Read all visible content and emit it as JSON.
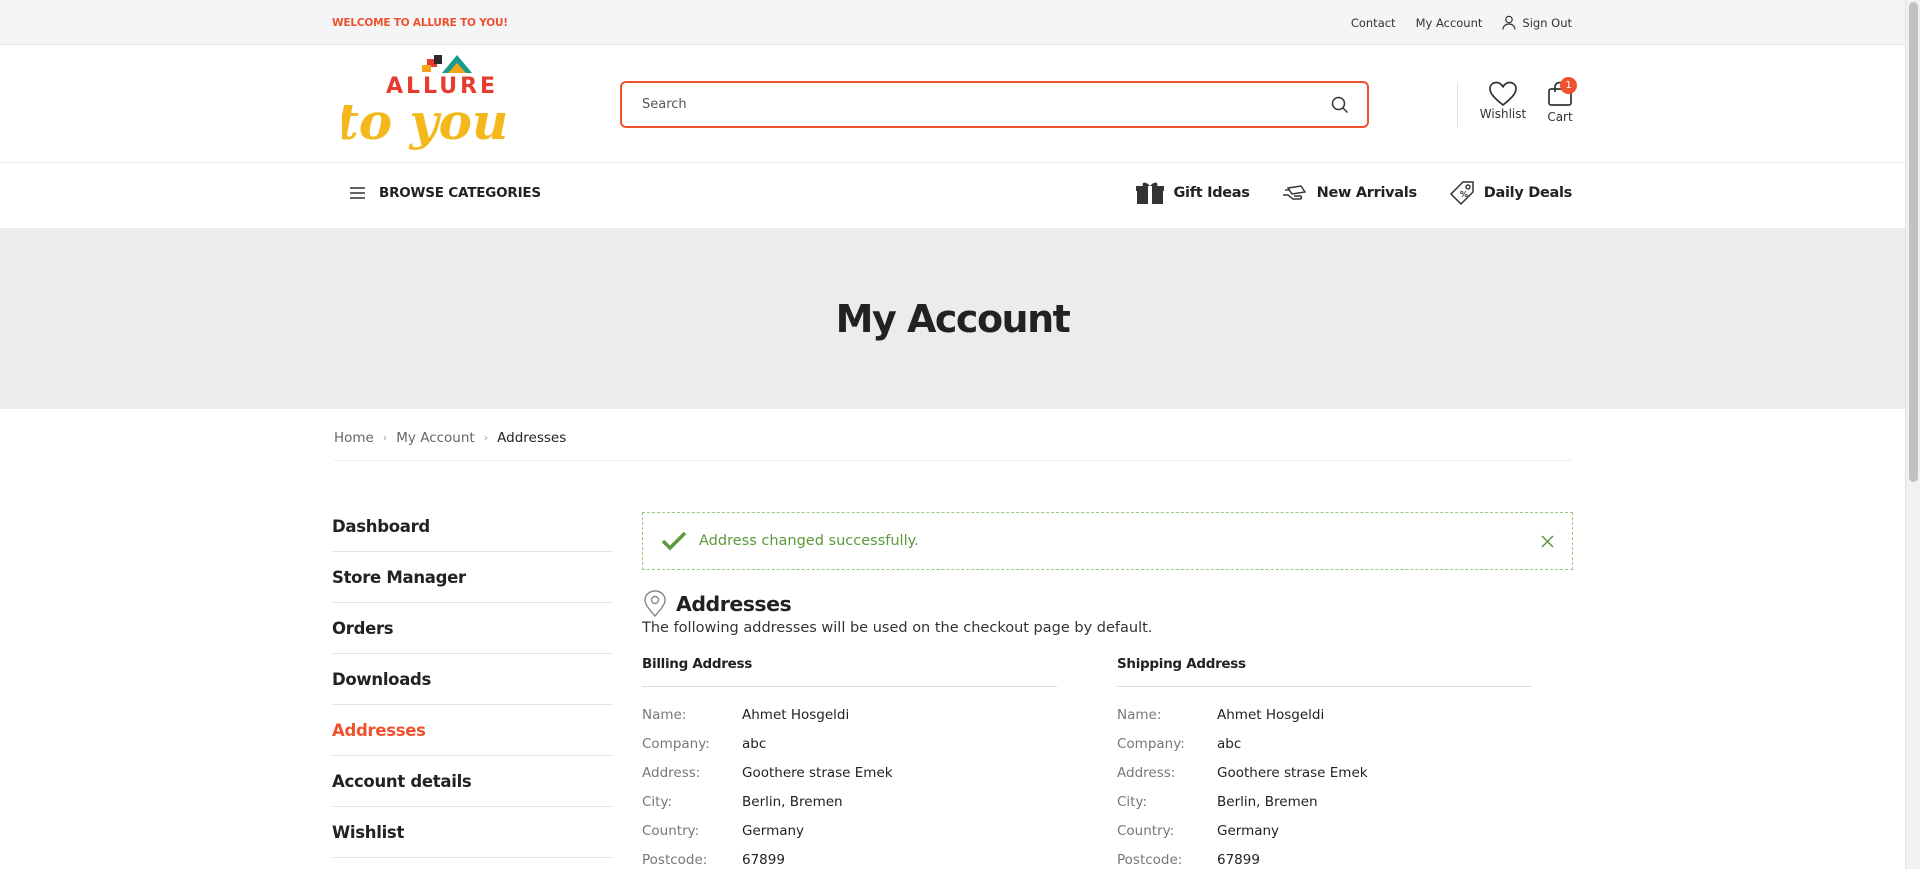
{
  "topbar": {
    "welcome": "WELCOME TO ALLURE TO YOU!",
    "contact": "Contact",
    "my_account": "My Account",
    "sign_out": "Sign Out"
  },
  "header": {
    "logo_text_top": "ALLURE",
    "logo_text_bottom": "to you",
    "search_placeholder": "Search",
    "wishlist_label": "Wishlist",
    "cart_label": "Cart",
    "cart_count": "1"
  },
  "nav": {
    "browse_label": "BROWSE CATEGORIES",
    "links": [
      {
        "label": "Gift Ideas",
        "icon": "gift-icon"
      },
      {
        "label": "New Arrivals",
        "icon": "hand-delivery-icon"
      },
      {
        "label": "Daily Deals",
        "icon": "tag-icon"
      }
    ]
  },
  "banner": {
    "title": "My Account"
  },
  "breadcrumb": [
    "Home",
    "My Account",
    "Addresses"
  ],
  "sidebar": {
    "items": [
      "Dashboard",
      "Store Manager",
      "Orders",
      "Downloads",
      "Addresses",
      "Account details",
      "Wishlist"
    ],
    "active": "Addresses"
  },
  "notice": {
    "message": "Address changed successfully."
  },
  "addresses": {
    "title": "Addresses",
    "description": "The following addresses will be used on the checkout page by default.",
    "billing": {
      "title": "Billing Address",
      "rows": [
        {
          "key": "Name:",
          "value": "Ahmet Hosgeldi"
        },
        {
          "key": "Company:",
          "value": "abc"
        },
        {
          "key": "Address:",
          "value": "Goothere strase Emek"
        },
        {
          "key": "City:",
          "value": "Berlin, Bremen"
        },
        {
          "key": "Country:",
          "value": "Germany"
        },
        {
          "key": "Postcode:",
          "value": "67899"
        }
      ]
    },
    "shipping": {
      "title": "Shipping Address",
      "rows": [
        {
          "key": "Name:",
          "value": "Ahmet Hosgeldi"
        },
        {
          "key": "Company:",
          "value": "abc"
        },
        {
          "key": "Address:",
          "value": "Goothere strase Emek"
        },
        {
          "key": "City:",
          "value": "Berlin, Bremen"
        },
        {
          "key": "Country:",
          "value": "Germany"
        },
        {
          "key": "Postcode:",
          "value": "67899"
        }
      ]
    }
  },
  "colors": {
    "accent": "#f0512d",
    "success": "#5a9a3a",
    "banner_bg": "#ececec"
  }
}
